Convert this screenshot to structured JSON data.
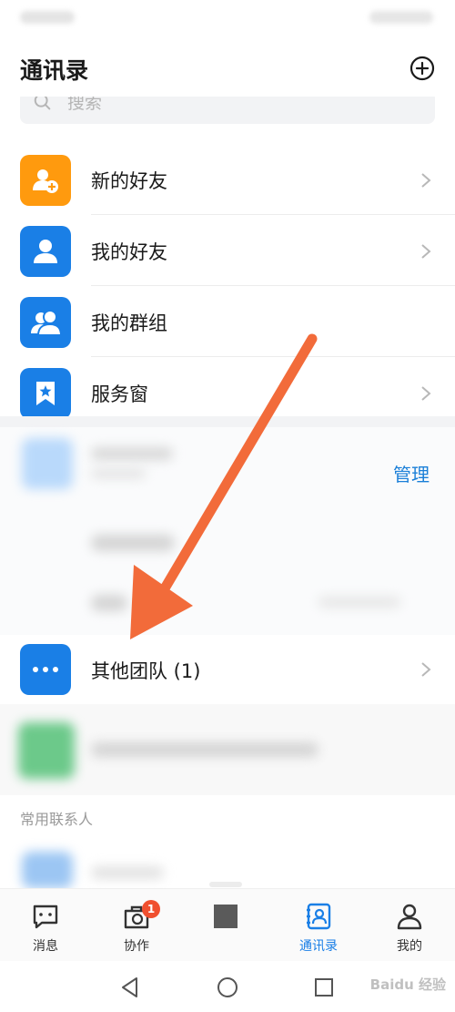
{
  "header": {
    "title": "通讯录"
  },
  "search": {
    "placeholder": "搜索"
  },
  "menu": [
    {
      "label": "新的好友",
      "color": "#ff9a0e",
      "icon": "add-person-icon"
    },
    {
      "label": "我的好友",
      "color": "#1a7fe6",
      "icon": "person-icon"
    },
    {
      "label": "我的群组",
      "color": "#1a7fe6",
      "icon": "group-icon"
    },
    {
      "label": "服务窗",
      "color": "#1a7fe6",
      "icon": "bookmark-star-icon"
    }
  ],
  "teams": {
    "manage_label": "管理",
    "other_label": "其他团队 (1)"
  },
  "frequent": {
    "title": "常用联系人"
  },
  "tabs": [
    {
      "label": "消息",
      "icon": "message-icon"
    },
    {
      "label": "协作",
      "icon": "collaboration-icon",
      "badge": "1"
    },
    {
      "label": "",
      "icon": "square-icon"
    },
    {
      "label": "通讯录",
      "icon": "contacts-icon",
      "active": true
    },
    {
      "label": "我的",
      "icon": "profile-icon"
    }
  ],
  "watermark": "Baidu 经验",
  "colors": {
    "accent": "#1a7fe6",
    "orange": "#ff9a0e",
    "arrow": "#f26b3a",
    "badge": "#f0502f"
  }
}
